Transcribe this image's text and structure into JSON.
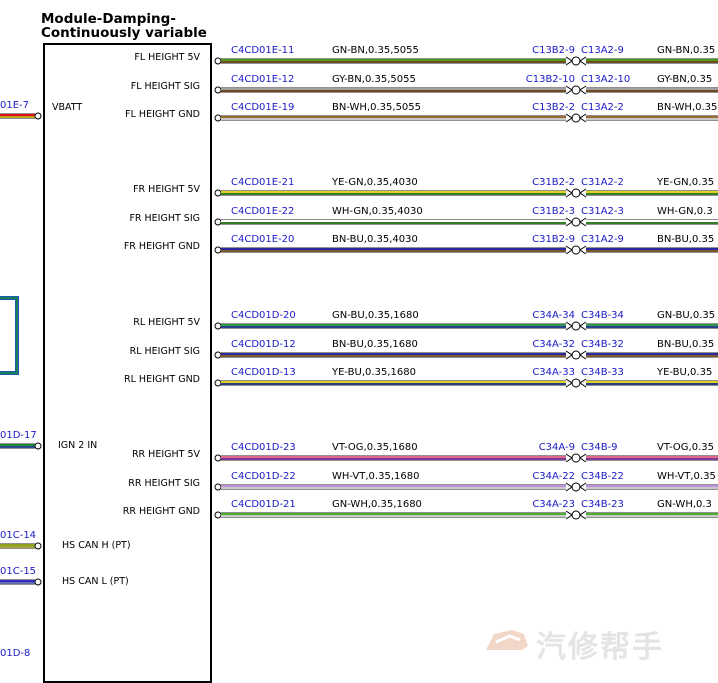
{
  "module": {
    "title_line1": "Module-Damping-",
    "title_line2": "Continuously variable"
  },
  "left_pins": [
    {
      "name": "VBATT",
      "connector": "01E-7",
      "wire_colors": [
        "#e01010",
        "#f0d020"
      ]
    },
    {
      "name": "IGN 2 IN",
      "connector": "01D-17",
      "wire_colors": [
        "#1a8a3a",
        "#2a5ab0"
      ]
    },
    {
      "name": "HS CAN H (PT)",
      "connector": "01C-14",
      "wire_colors": [
        "#90a020",
        "#d0d040"
      ]
    },
    {
      "name": "HS CAN L (PT)",
      "connector": "01C-15",
      "wire_colors": [
        "#3030c0",
        "#8080e0"
      ]
    },
    {
      "name": "",
      "connector": "01D-8",
      "wire_colors": []
    }
  ],
  "groups": [
    {
      "name": "FL",
      "pins": [
        {
          "label": "FL HEIGHT 5V",
          "connector": "C4CD01E-11",
          "wire": "GN-BN,0.35,5055",
          "inline_left": "C13B2-9",
          "inline_right": "C13A2-9",
          "out_wire": "GN-BN,0.35",
          "colors": [
            "#4a9a1a",
            "#8a5a20"
          ]
        },
        {
          "label": "FL HEIGHT SIG",
          "connector": "C4CD01E-12",
          "wire": "GY-BN,0.35,5055",
          "inline_left": "C13B2-10",
          "inline_right": "C13A2-10",
          "out_wire": "GY-BN,0.35",
          "colors": [
            "#a0a0a0",
            "#8a5a20"
          ]
        },
        {
          "label": "FL HEIGHT GND",
          "connector": "C4CD01E-19",
          "wire": "BN-WH,0.35,5055",
          "inline_left": "C13B2-2",
          "inline_right": "C13A2-2",
          "out_wire": "BN-WH,0.35",
          "colors": [
            "#9a6a30",
            "#ffffff"
          ]
        }
      ]
    },
    {
      "name": "FR",
      "pins": [
        {
          "label": "FR HEIGHT 5V",
          "connector": "C4CD01E-21",
          "wire": "YE-GN,0.35,4030",
          "inline_left": "C31B2-2",
          "inline_right": "C31A2-2",
          "out_wire": "YE-GN,0.35",
          "colors": [
            "#e0d020",
            "#3a9a2a"
          ]
        },
        {
          "label": "FR HEIGHT SIG",
          "connector": "C4CD01E-22",
          "wire": "WH-GN,0.35,4030",
          "inline_left": "C31B2-3",
          "inline_right": "C31A2-3",
          "out_wire": "WH-GN,0.3",
          "colors": [
            "#ffffff",
            "#3a9a2a"
          ]
        },
        {
          "label": "FR HEIGHT GND",
          "connector": "C4CD01E-20",
          "wire": "BN-BU,0.35,4030",
          "inline_left": "C31B2-9",
          "inline_right": "C31A2-9",
          "out_wire": "BN-BU,0.35",
          "colors": [
            "#2a2aa0",
            "#9a6a30"
          ]
        }
      ]
    },
    {
      "name": "RL",
      "pins": [
        {
          "label": "RL HEIGHT 5V",
          "connector": "C4CD01D-20",
          "wire": "GN-BU,0.35,1680",
          "inline_left": "C34A-34",
          "inline_right": "C34B-34",
          "out_wire": "GN-BU,0.35",
          "colors": [
            "#2a9a4a",
            "#2a4ab0"
          ]
        },
        {
          "label": "RL HEIGHT SIG",
          "connector": "C4CD01D-12",
          "wire": "BN-BU,0.35,1680",
          "inline_left": "C34A-32",
          "inline_right": "C34B-32",
          "out_wire": "BN-BU,0.35",
          "colors": [
            "#2a2aa0",
            "#9a6a30"
          ]
        },
        {
          "label": "RL HEIGHT GND",
          "connector": "C4CD01D-13",
          "wire": "YE-BU,0.35,1680",
          "inline_left": "C34A-33",
          "inline_right": "C34B-33",
          "out_wire": "YE-BU,0.35",
          "colors": [
            "#e0d020",
            "#2a4ab0"
          ]
        }
      ]
    },
    {
      "name": "RR",
      "pins": [
        {
          "label": "RR HEIGHT 5V",
          "connector": "C4CD01D-23",
          "wire": "VT-OG,0.35,1680",
          "inline_left": "C34A-9",
          "inline_right": "C34B-9",
          "out_wire": "VT-OG,0.35",
          "colors": [
            "#e06a8a",
            "#a040c0"
          ]
        },
        {
          "label": "RR HEIGHT SIG",
          "connector": "C4CD01D-22",
          "wire": "WH-VT,0.35,1680",
          "inline_left": "C34A-22",
          "inline_right": "C34B-22",
          "out_wire": "WH-VT,0.35",
          "colors": [
            "#c090e0",
            "#ffffff"
          ]
        },
        {
          "label": "RR HEIGHT GND",
          "connector": "C4CD01D-21",
          "wire": "GN-WH,0.35,1680",
          "inline_left": "C34A-23",
          "inline_right": "C34B-23",
          "out_wire": "GN-WH,0.3",
          "colors": [
            "#4ab02a",
            "#ffffff"
          ]
        }
      ]
    }
  ],
  "watermark": {
    "text": "汽修帮手",
    "color": "#e8e8e8"
  }
}
